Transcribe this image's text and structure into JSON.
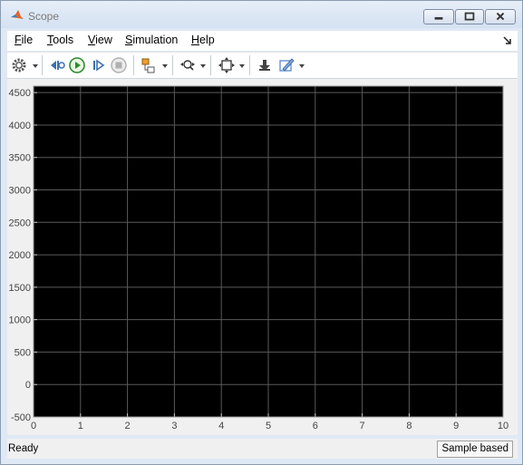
{
  "window": {
    "title": "Scope"
  },
  "menu": [
    {
      "label": "File",
      "mnemonic": "F",
      "rest": "ile"
    },
    {
      "label": "Tools",
      "mnemonic": "T",
      "rest": "ools"
    },
    {
      "label": "View",
      "mnemonic": "V",
      "rest": "iew"
    },
    {
      "label": "Simulation",
      "mnemonic": "S",
      "rest": "imulation"
    },
    {
      "label": "Help",
      "mnemonic": "H",
      "rest": "elp"
    }
  ],
  "toolbar": {
    "icons": [
      "settings-icon",
      "step-back-icon",
      "run-icon",
      "step-forward-icon",
      "stop-icon",
      "signal-selector-icon",
      "zoom-icon",
      "autoscale-icon",
      "highlight-block-icon",
      "style-icon"
    ]
  },
  "chart_data": {
    "type": "line",
    "title": "",
    "xlabel": "",
    "ylabel": "",
    "xlim": [
      0,
      10
    ],
    "ylim": [
      -500,
      4600
    ],
    "x_ticks": [
      0,
      1,
      2,
      3,
      4,
      5,
      6,
      7,
      8,
      9,
      10
    ],
    "y_ticks": [
      -500,
      0,
      500,
      1000,
      1500,
      2000,
      2500,
      3000,
      3500,
      4000,
      4500
    ],
    "grid": true,
    "background": "#000000",
    "grid_color": "#5a5a5a",
    "series": []
  },
  "status": {
    "left": "Ready",
    "right": "Sample based"
  }
}
